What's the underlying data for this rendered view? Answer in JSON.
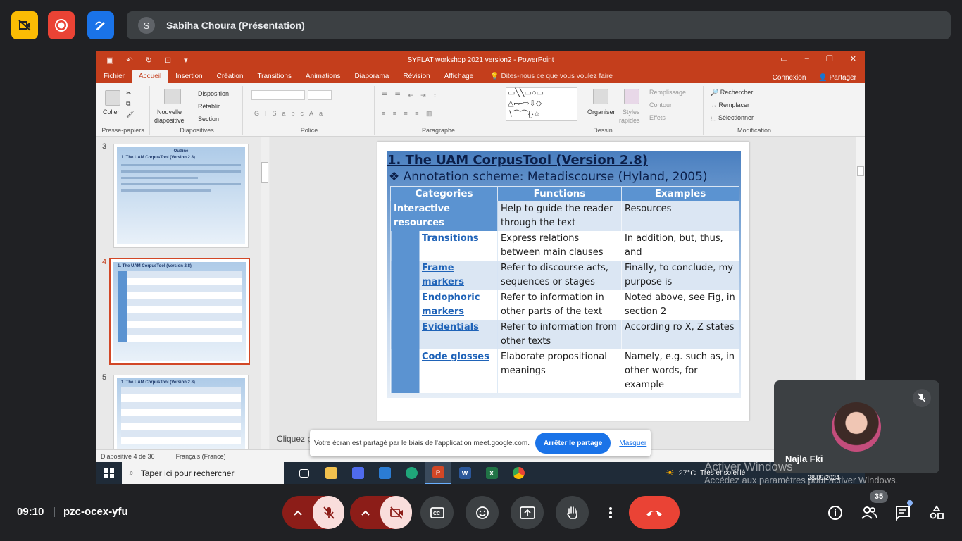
{
  "meet": {
    "presenter_initial": "S",
    "presenter_label": "Sabiha Choura (Présentation)",
    "time": "09:10",
    "separator": "|",
    "meeting_code": "pzc-ocex-yfu",
    "participants_count": "35",
    "self_name": "Najla Fki",
    "accent_red": "#ea4335",
    "accent_blue": "#1a73e8"
  },
  "share_banner": {
    "message": "Votre écran est partagé par le biais de l'application meet.google.com.",
    "stop_label": "Arrêter le partage",
    "hide_label": "Masquer"
  },
  "activate_windows": {
    "line1": "Activer Windows",
    "line2": "Accédez aux paramètres pour activer Windows."
  },
  "powerpoint": {
    "window_title": "SYFLAT workshop 2021 version2 - PowerPoint",
    "tabs": [
      "Fichier",
      "Accueil",
      "Insertion",
      "Création",
      "Transitions",
      "Animations",
      "Diaporama",
      "Révision",
      "Affichage"
    ],
    "tell_me": "Dites-nous ce que vous voulez faire",
    "connexion": "Connexion",
    "partager": "Partager",
    "ribbon": {
      "coller": "Coller",
      "presse_papiers": "Presse-papiers",
      "nouvelle": "Nouvelle",
      "diapositive": "diapositive",
      "disposition": "Disposition",
      "retablir": "Rétablir",
      "section": "Section",
      "diapositives": "Diapositives",
      "police": "Police",
      "paragraphe": "Paragraphe",
      "organiser": "Organiser",
      "styles": "Styles",
      "rapides": "rapides",
      "remplissage": "Remplissage",
      "contour": "Contour",
      "effets": "Effets",
      "dessin": "Dessin",
      "rechercher": "Rechercher",
      "remplacer": "Remplacer",
      "selectionner": "Sélectionner",
      "modification": "Modification"
    },
    "thumbnails": [
      {
        "num": "3",
        "title": "Outline",
        "line": "1. The UAM CorpusTool (Version 2.8)"
      },
      {
        "num": "4",
        "title": "1. The UAM CorpusTool (Version 2.8)",
        "line": ""
      },
      {
        "num": "5",
        "title": "1. The UAM CorpusTool (Version 2.8)",
        "line": ""
      }
    ],
    "slide": {
      "title": "1. The UAM CorpusTool (Version 2.8)",
      "subtitle": "❖ Annotation scheme: Metadiscourse (Hyland, 2005)",
      "headers": [
        "Categories",
        "Functions",
        "Examples"
      ],
      "rows": [
        {
          "category": "Interactive resources",
          "function": "Help to guide the reader through the text",
          "example": "Resources"
        },
        {
          "category": "Transitions",
          "function": "Express relations between main clauses",
          "example": "In addition, but, thus, and"
        },
        {
          "category": "Frame markers",
          "function": "Refer to discourse acts, sequences or stages",
          "example": "Finally, to conclude, my purpose is"
        },
        {
          "category": "Endophoric markers",
          "function": "Refer to information in other parts of the text",
          "example": "Noted above, see Fig, in section 2"
        },
        {
          "category": "Evidentials",
          "function": "Refer to information from other texts",
          "example": "According ro X, Z states"
        },
        {
          "category": "Code glosses",
          "function": "Elaborate propositional meanings",
          "example": "Namely, e.g. such as, in other words, for example"
        }
      ]
    },
    "notes_placeholder": "Cliquez p",
    "status_slide": "Diapositive 4 de 36",
    "status_lang": "Français (France)"
  },
  "taskbar": {
    "search_placeholder": "Taper ici pour rechercher",
    "weather_temp": "27°C",
    "weather_desc": "Très ensoleillé",
    "date": "28/09/2024"
  }
}
